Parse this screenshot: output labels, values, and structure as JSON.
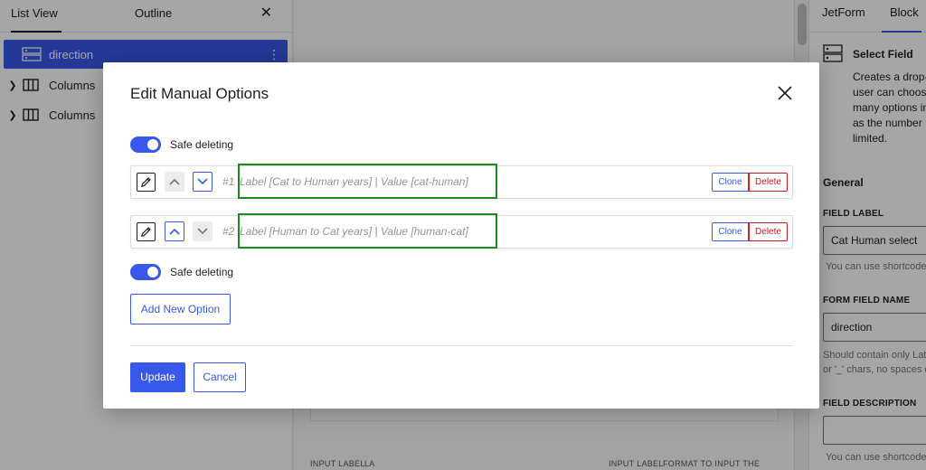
{
  "left_panel": {
    "tabs": [
      {
        "label": "List View",
        "active": true
      },
      {
        "label": "Outline",
        "active": false
      }
    ],
    "close_icon": "close-icon",
    "items": [
      {
        "label": "direction",
        "selected": true,
        "icon": "select-field-icon"
      },
      {
        "label": "Columns",
        "selected": false,
        "icon": "columns-icon"
      },
      {
        "label": "Columns",
        "selected": false,
        "icon": "columns-icon"
      }
    ]
  },
  "canvas": {
    "hints": [
      "INPUT LABEL",
      "LA",
      "INPUT LABEL",
      "FORMAT TO INPUT THE"
    ]
  },
  "right_panel": {
    "tabs": [
      {
        "label": "JetForm",
        "active": false
      },
      {
        "label": "Block",
        "active": true
      }
    ],
    "block_title": "Select Field",
    "block_description": [
      "Creates a drop-",
      "user can choose",
      "many options in",
      "as the number",
      "limited."
    ],
    "section_title": "General",
    "field_label_title": "FIELD LABEL",
    "field_label_value": "Cat Human select",
    "field_label_help": "You can use shortcodes",
    "form_field_name_title": "FORM FIELD NAME",
    "form_field_name_value": "direction",
    "form_field_name_help": [
      "Should contain only Lat",
      "or '_' chars, no spaces o"
    ],
    "field_description_title": "FIELD DESCRIPTION",
    "field_description_value": "",
    "field_description_help": "You can use shortcodes"
  },
  "modal": {
    "title": "Edit Manual Options",
    "safe_deleting_label": "Safe deleting",
    "safe_deleting_on": true,
    "options": [
      {
        "number": "#1",
        "text": "Label [Cat to Human years] | Value [cat-human]",
        "up_enabled": false,
        "down_enabled": true
      },
      {
        "number": "#2",
        "text": "Label [Human to Cat years] | Value [human-cat]",
        "up_enabled": true,
        "down_enabled": false
      }
    ],
    "clone_label": "Clone",
    "delete_label": "Delete",
    "add_option_label": "Add New Option",
    "update_label": "Update",
    "cancel_label": "Cancel"
  },
  "colors": {
    "accent": "#3858e9",
    "danger": "#cc1818",
    "highlight": "#1c8a1c"
  }
}
